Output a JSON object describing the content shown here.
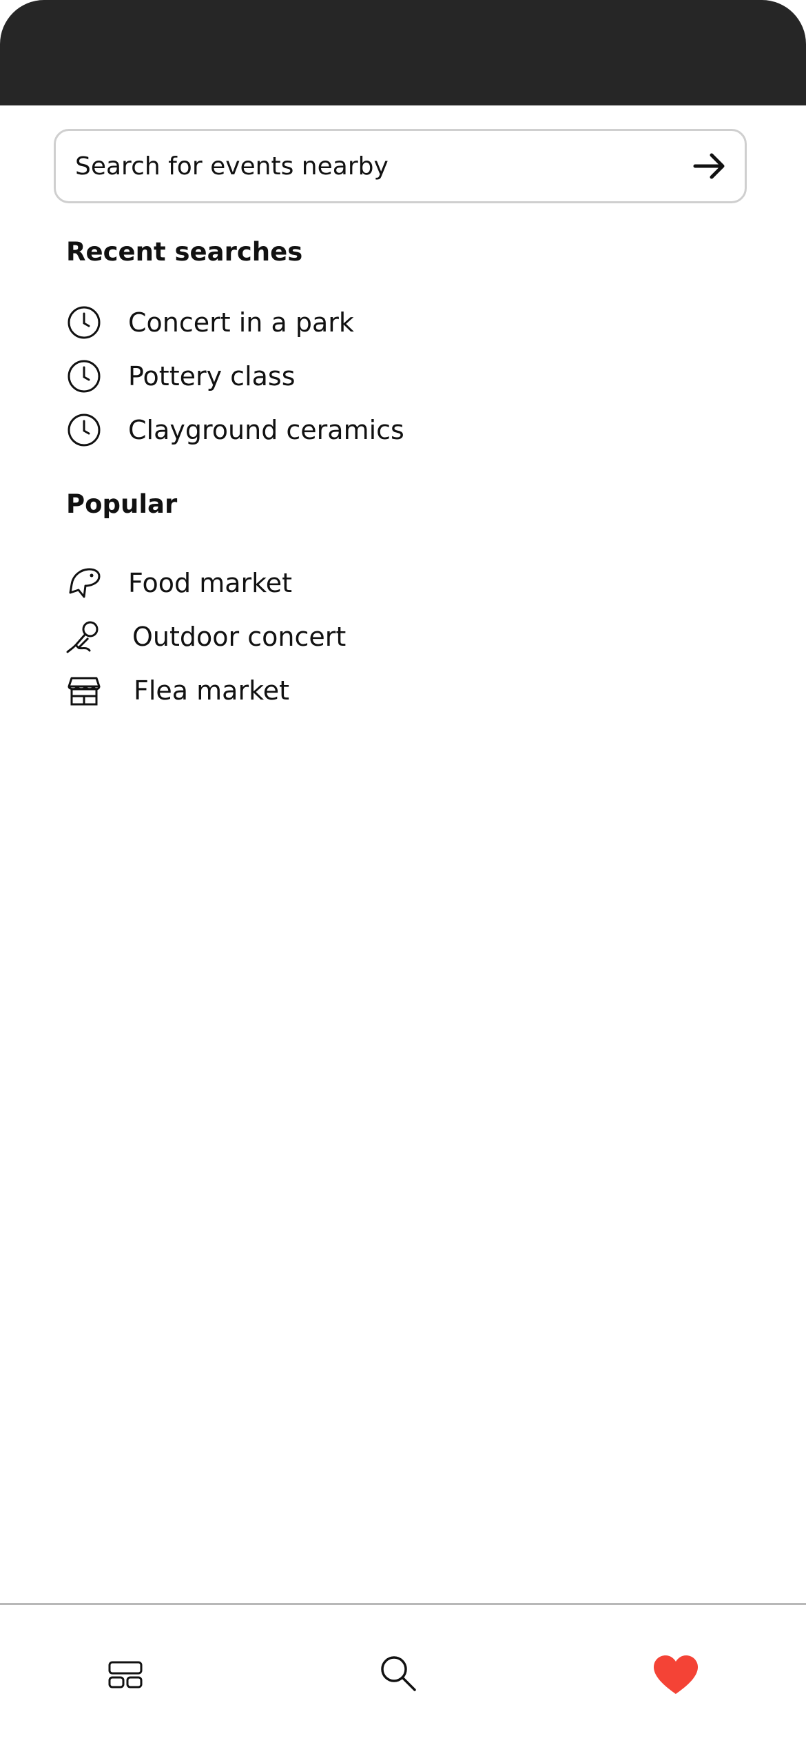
{
  "search": {
    "placeholder": "Search for events nearby",
    "value": "",
    "submit_icon": "arrow-right-icon"
  },
  "recent": {
    "heading": "Recent searches",
    "icon": "clock-icon",
    "items": [
      {
        "label": "Concert in a park"
      },
      {
        "label": "Pottery class"
      },
      {
        "label": "Clayground ceramics"
      }
    ]
  },
  "popular": {
    "heading": "Popular",
    "items": [
      {
        "label": "Food market",
        "icon": "food-icon"
      },
      {
        "label": "Outdoor concert",
        "icon": "microphone-icon"
      },
      {
        "label": "Flea market",
        "icon": "storefront-icon"
      }
    ]
  },
  "bottom_nav": {
    "items": [
      {
        "icon": "layout-grid-icon",
        "active": false
      },
      {
        "icon": "search-icon",
        "active": false
      },
      {
        "icon": "heart-icon",
        "active": true
      }
    ]
  },
  "colors": {
    "status_bar": "#262626",
    "accent_heart": "#f44336",
    "text": "#111111",
    "border": "#cfcfcf"
  }
}
